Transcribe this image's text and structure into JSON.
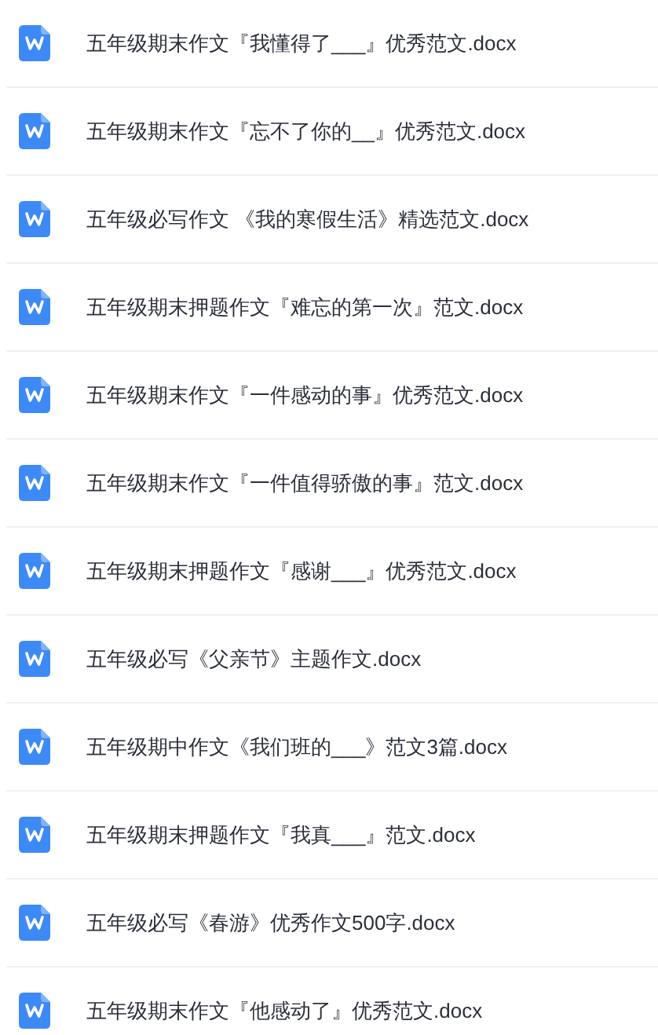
{
  "files": [
    {
      "name": "五年级期末作文『我懂得了___』优秀范文.docx"
    },
    {
      "name": "五年级期末作文『忘不了你的__』优秀范文.docx"
    },
    {
      "name": "五年级必写作文 《我的寒假生活》精选范文.docx"
    },
    {
      "name": "五年级期末押题作文『难忘的第一次』范文.docx"
    },
    {
      "name": "五年级期末作文『一件感动的事』优秀范文.docx"
    },
    {
      "name": "五年级期末作文『一件值得骄傲的事』范文.docx"
    },
    {
      "name": "五年级期末押题作文『感谢___』优秀范文.docx"
    },
    {
      "name": "五年级必写《父亲节》主题作文.docx"
    },
    {
      "name": "五年级期中作文《我们班的___》范文3篇.docx"
    },
    {
      "name": "五年级期末押题作文『我真___』范文.docx"
    },
    {
      "name": "五年级必写《春游》优秀作文500字.docx"
    },
    {
      "name": "五年级期末作文『他感动了』优秀范文.docx"
    }
  ]
}
